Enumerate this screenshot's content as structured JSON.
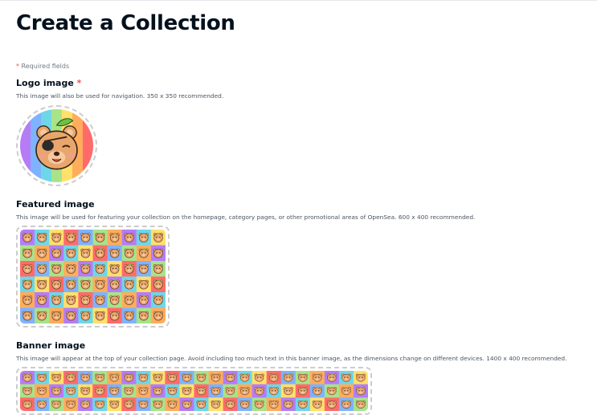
{
  "page": {
    "title": "Create a Collection",
    "required_note_star": "*",
    "required_note": " Required fields"
  },
  "logo": {
    "label": "Logo image",
    "required_star": " *",
    "description": "This image will also be used for navigation. 350 x 350 recommended."
  },
  "featured": {
    "label": "Featured image",
    "description": "This image will be used for featuring your collection on the homepage, category pages, or other promotional areas of OpenSea. 600 x 400 recommended."
  },
  "banner": {
    "label": "Banner image",
    "description": "This image will appear at the top of your collection page. Avoid including too much text in this banner image, as the dimensions change on different devices. 1400 x 400 recommended."
  },
  "colors": {
    "rainbow": [
      "#b57cf5",
      "#7fb2ff",
      "#6fd6e8",
      "#a8e38a",
      "#ffe06b",
      "#ffad5c",
      "#ff6b6b"
    ],
    "bear_fur": "#e9a66c",
    "required_star": "#eb5757"
  },
  "icons": [
    "bear-logo-icon",
    "bear-pattern-image"
  ]
}
